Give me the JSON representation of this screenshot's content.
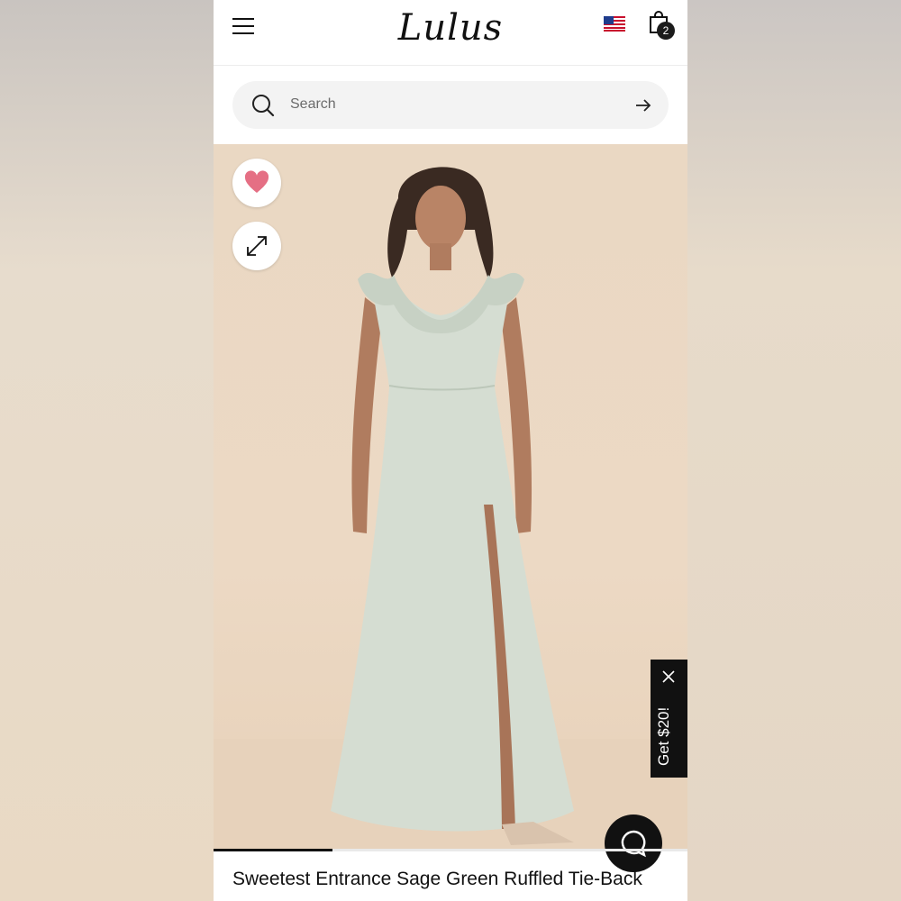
{
  "header": {
    "logo_text": "Lulus",
    "bag_count": "2",
    "icons": [
      "menu-icon",
      "us-flag-icon",
      "shopping-bag-icon"
    ]
  },
  "search": {
    "placeholder": "Search"
  },
  "product": {
    "title": "Sweetest Entrance Sage Green Ruffled Tie-Back",
    "image_progress": 0.25,
    "dress_color": "#d5ddd2"
  },
  "promo": {
    "label": "Get $20!"
  },
  "colors": {
    "heart": "#e56f84",
    "dark": "#111111"
  }
}
